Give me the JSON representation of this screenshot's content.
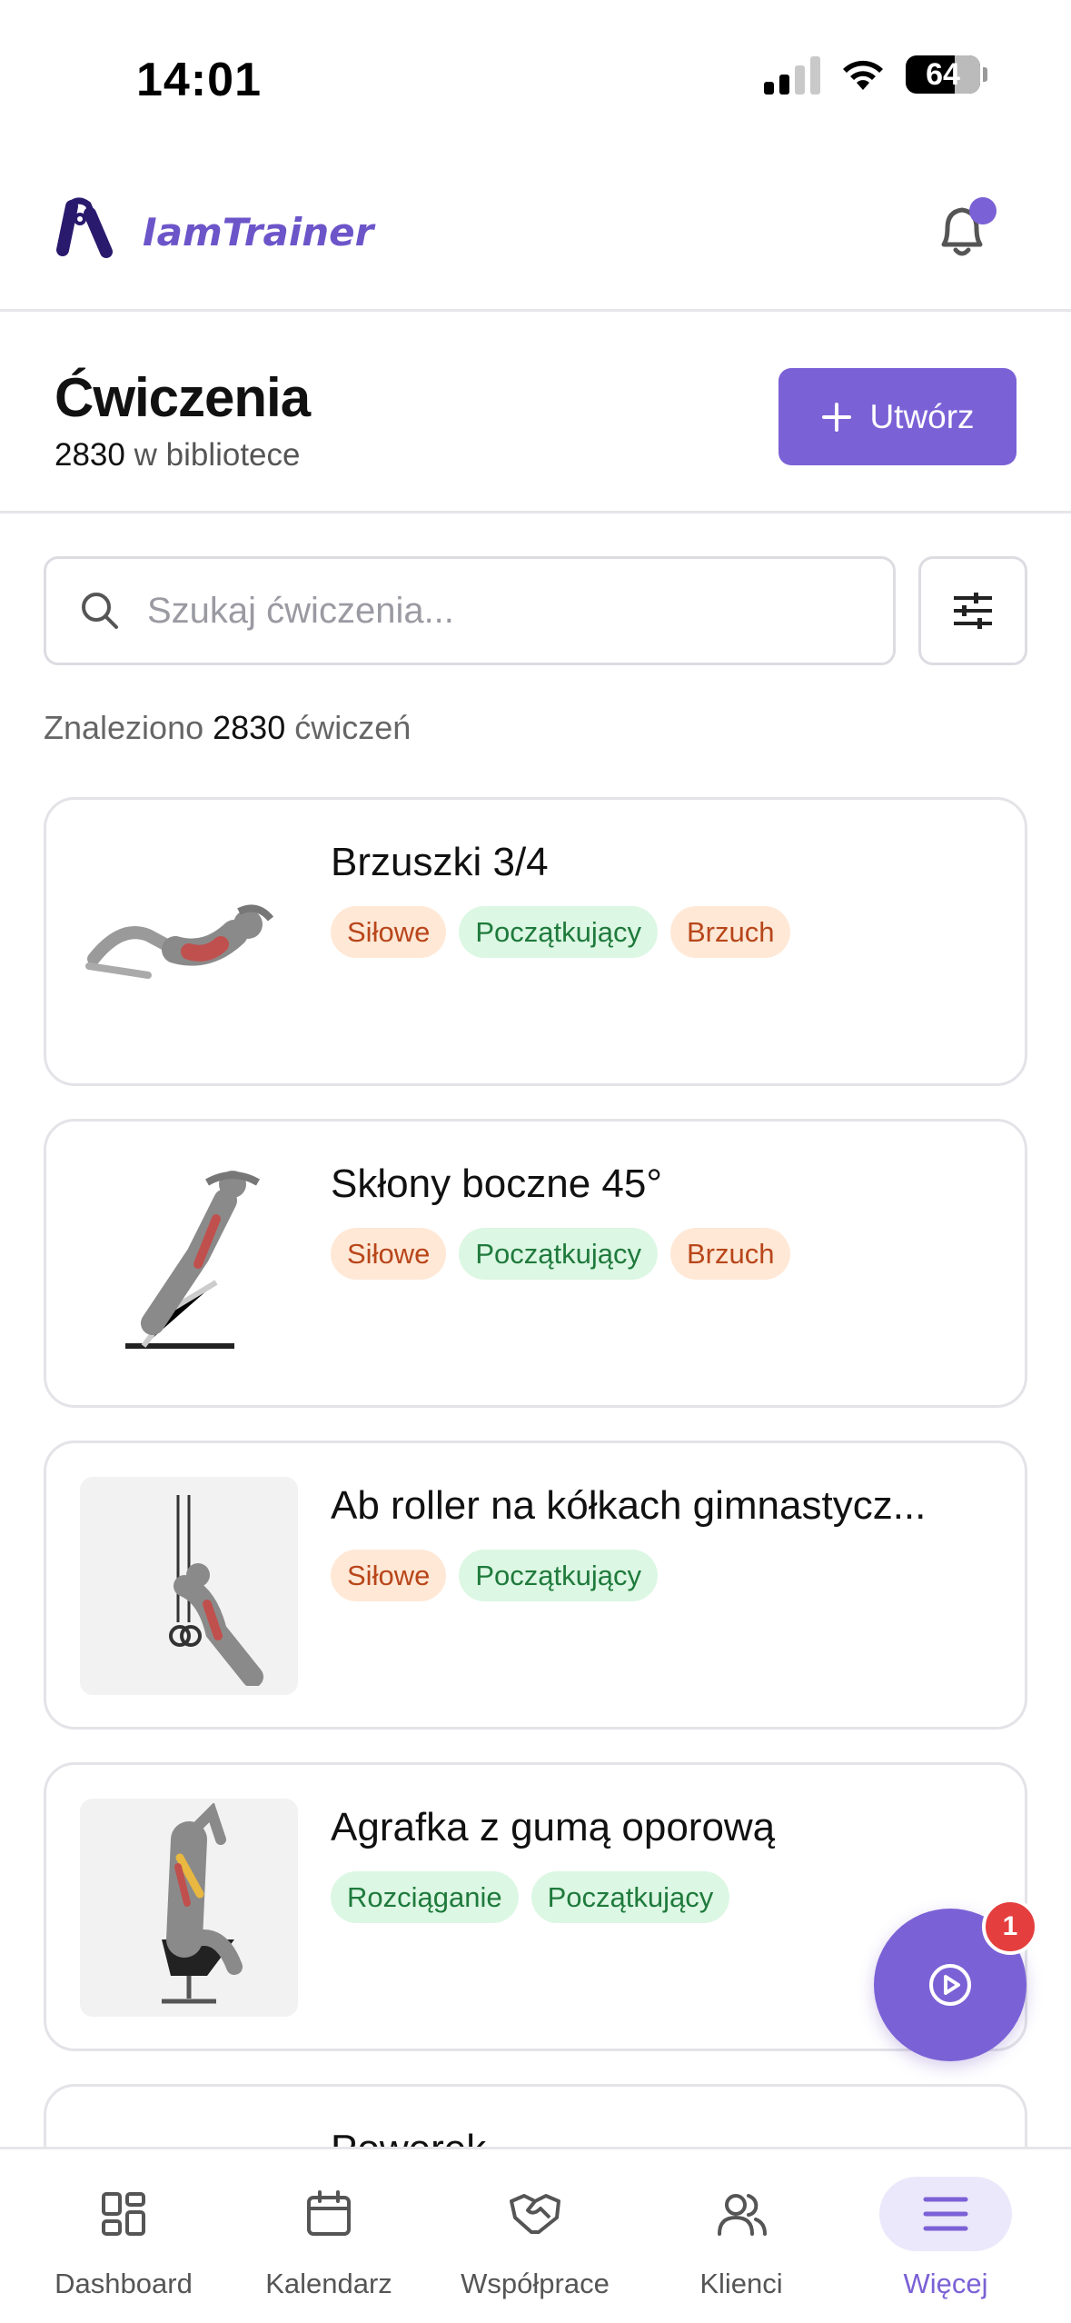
{
  "status_bar": {
    "time": "14:01",
    "battery": "64"
  },
  "header": {
    "app_name": "IamTrainer",
    "logo_icon": "hand-gripper-icon",
    "notification_icon": "bell-icon"
  },
  "page": {
    "title": "Ćwiczenia",
    "count": "2830",
    "count_suffix": "w bibliotece",
    "create_label": "Utwórz"
  },
  "search": {
    "placeholder": "Szukaj ćwiczenia..."
  },
  "results": {
    "prefix": "Znaleziono",
    "count": "2830",
    "suffix": "ćwiczeń"
  },
  "exercises": [
    {
      "title": "Brzuszki 3/4",
      "tags": [
        "Siłowe",
        "Początkujący",
        "Brzuch"
      ]
    },
    {
      "title": "Skłony boczne 45°",
      "tags": [
        "Siłowe",
        "Początkujący",
        "Brzuch"
      ]
    },
    {
      "title": "Ab roller na kółkach gimnastycz...",
      "tags": [
        "Siłowe",
        "Początkujący"
      ]
    },
    {
      "title": "Agrafka z gumą oporową",
      "tags": [
        "Rozciąganie",
        "Początkujący"
      ]
    },
    {
      "title": "Powerek"
    }
  ],
  "fab": {
    "badge": "1",
    "icon": "play-circle-icon"
  },
  "nav": [
    {
      "label": "Dashboard",
      "icon": "dashboard-icon"
    },
    {
      "label": "Kalendarz",
      "icon": "calendar-icon"
    },
    {
      "label": "Współprace",
      "icon": "handshake-icon"
    },
    {
      "label": "Klienci",
      "icon": "users-icon"
    },
    {
      "label": "Więcej",
      "icon": "menu-icon"
    }
  ],
  "colors": {
    "accent": "#7b61d6",
    "tag_orange_bg": "#ffe8d6",
    "tag_green_bg": "#dcf7e3",
    "badge": "#e53e3e"
  }
}
